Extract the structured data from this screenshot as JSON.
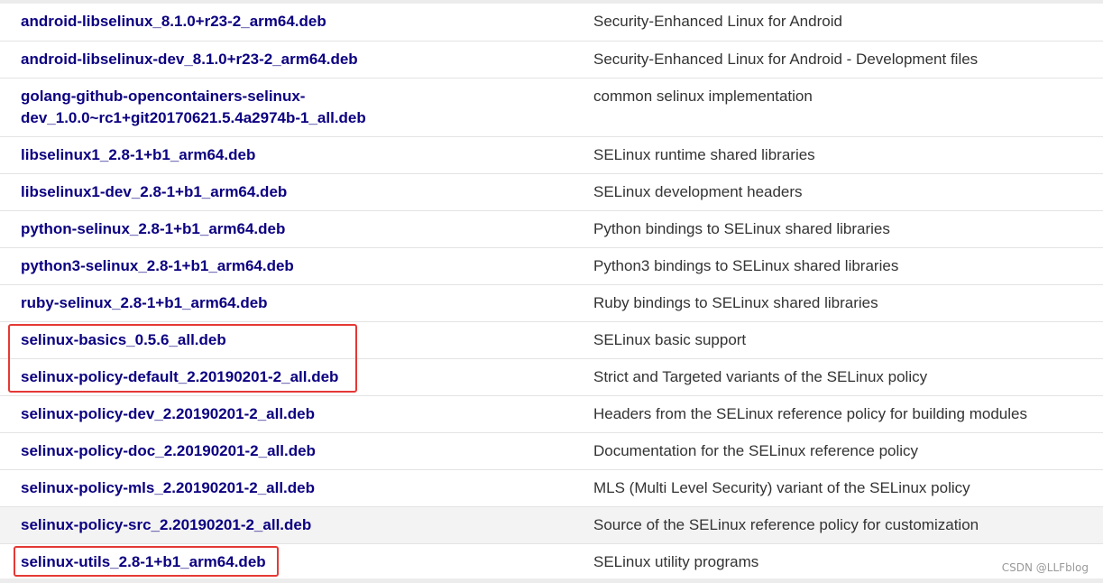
{
  "packages": [
    {
      "name": "android-libselinux_8.1.0+r23-2_arm64.deb",
      "description": "Security-Enhanced Linux for Android"
    },
    {
      "name": "android-libselinux-dev_8.1.0+r23-2_arm64.deb",
      "description": "Security-Enhanced Linux for Android - Development files"
    },
    {
      "name_line1": "golang-github-opencontainers-selinux-",
      "name_line2": "dev_1.0.0~rc1+git20170621.5.4a2974b-1_all.deb",
      "description": "common selinux implementation"
    },
    {
      "name": "libselinux1_2.8-1+b1_arm64.deb",
      "description": "SELinux runtime shared libraries"
    },
    {
      "name": "libselinux1-dev_2.8-1+b1_arm64.deb",
      "description": "SELinux development headers"
    },
    {
      "name": "python-selinux_2.8-1+b1_arm64.deb",
      "description": "Python bindings to SELinux shared libraries"
    },
    {
      "name": "python3-selinux_2.8-1+b1_arm64.deb",
      "description": "Python3 bindings to SELinux shared libraries"
    },
    {
      "name": "ruby-selinux_2.8-1+b1_arm64.deb",
      "description": "Ruby bindings to SELinux shared libraries"
    },
    {
      "name": "selinux-basics_0.5.6_all.deb",
      "description": "SELinux basic support"
    },
    {
      "name": "selinux-policy-default_2.20190201-2_all.deb",
      "description": "Strict and Targeted variants of the SELinux policy"
    },
    {
      "name": "selinux-policy-dev_2.20190201-2_all.deb",
      "description": "Headers from the SELinux reference policy for building modules"
    },
    {
      "name": "selinux-policy-doc_2.20190201-2_all.deb",
      "description": "Documentation for the SELinux reference policy"
    },
    {
      "name": "selinux-policy-mls_2.20190201-2_all.deb",
      "description": "MLS (Multi Level Security) variant of the SELinux policy"
    },
    {
      "name": "selinux-policy-src_2.20190201-2_all.deb",
      "description": "Source of the SELinux reference policy for customization"
    },
    {
      "name": "selinux-utils_2.8-1+b1_arm64.deb",
      "description": "SELinux utility programs"
    }
  ],
  "watermark": "CSDN @LLFblog",
  "colors": {
    "link": "#0b0080",
    "highlight": "#e53935",
    "row_alt": "#f3f3f3"
  }
}
